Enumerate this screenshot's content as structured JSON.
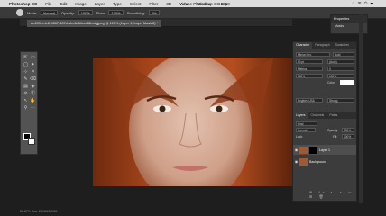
{
  "menubar": {
    "apple": "",
    "app": "Photoshop CC",
    "items": [
      "File",
      "Edit",
      "Image",
      "Layer",
      "Type",
      "Select",
      "Filter",
      "3D",
      "View",
      "Window",
      "Help"
    ],
    "window_title": "Adobe Photoshop CC 2018",
    "right": "⌂ ᯤ ⏻ ☰"
  },
  "options": {
    "mode_label": "Mode:",
    "mode_value": "Normal",
    "opacity_label": "Opacity:",
    "opacity_value": "100%",
    "flow_label": "Flow:",
    "flow_value": "100%",
    "smoothing_label": "Smoothing:",
    "smoothing_value": "0%"
  },
  "document": {
    "tab_title": "ae4531e-b4f-4567-987d-abe6a54cc468-edgjpeg @ 100% (Layer 1, Layer Mask/8) *"
  },
  "status": "66.67%   Doc: 2.64M/5.49M",
  "properties": {
    "title": "Properties",
    "row": "Masks"
  },
  "character": {
    "tabs": [
      "Character",
      "Paragraph",
      "Swatches"
    ],
    "font": "Minion Pro",
    "style": "Bold",
    "size": "60 pt",
    "leading": "(Auto)",
    "tracking": "Metrics",
    "kerning": "0",
    "scale": "100%",
    "color_label": "Color:",
    "lang": "English: USA",
    "aa": "Strong"
  },
  "layers": {
    "tabs": [
      "Layers",
      "Channels",
      "Paths"
    ],
    "kind": "Kind",
    "blend": "Normal",
    "opacity_label": "Opacity:",
    "opacity": "100%",
    "lock": "Lock:",
    "fill_label": "Fill:",
    "fill": "100%",
    "rows": [
      {
        "name": "Layer 1"
      },
      {
        "name": "Background"
      }
    ],
    "footer": "⊕ fx ◐ ◑ ▭ ⊞ 🗑"
  },
  "toolbar": {
    "tools": [
      "⇱",
      "▭",
      "◯",
      "✦",
      "⊹",
      "⌗",
      "✎",
      "⌫",
      "▤",
      "◈",
      "⊘",
      "Ⓣ",
      "↖",
      "✋",
      "⚲",
      "⋯"
    ]
  }
}
